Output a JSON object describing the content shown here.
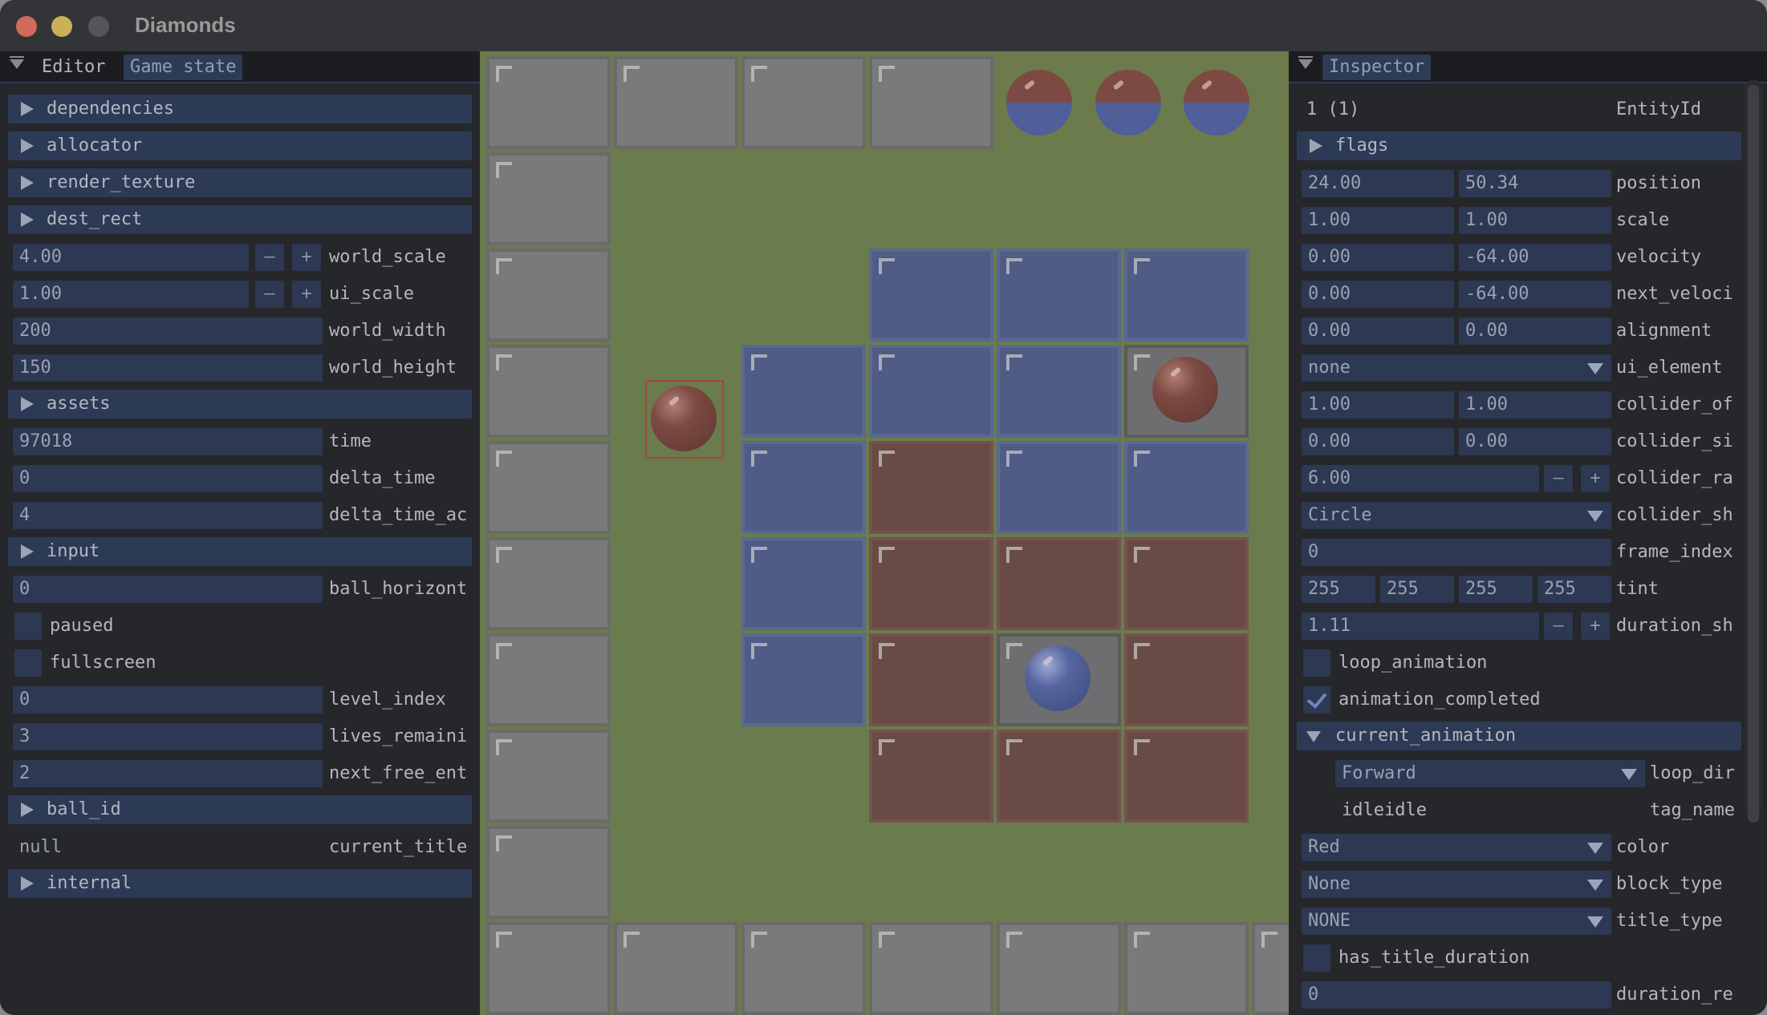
{
  "window": {
    "title": "Diamonds"
  },
  "left_panel": {
    "tabs": [
      "Editor",
      "Game state"
    ],
    "active_tab": "Game state",
    "sections": {
      "dependencies": "dependencies",
      "allocator": "allocator",
      "render_texture": "render_texture",
      "dest_rect": "dest_rect",
      "assets": "assets",
      "input": "input",
      "ball_id": "ball_id",
      "internal": "internal"
    },
    "fields": {
      "world_scale": {
        "value": "4.00",
        "label": "world_scale"
      },
      "ui_scale": {
        "value": "1.00",
        "label": "ui_scale"
      },
      "world_width": {
        "value": "200",
        "label": "world_width"
      },
      "world_height": {
        "value": "150",
        "label": "world_height"
      },
      "time": {
        "value": "97018",
        "label": "time"
      },
      "delta_time": {
        "value": "0",
        "label": "delta_time"
      },
      "delta_time_ac": {
        "value": "4",
        "label": "delta_time_ac"
      },
      "ball_horizont": {
        "value": "0",
        "label": "ball_horizont"
      },
      "paused": {
        "label": "paused",
        "checked": false
      },
      "fullscreen": {
        "label": "fullscreen",
        "checked": false
      },
      "level_index": {
        "value": "0",
        "label": "level_index"
      },
      "lives_remaini": {
        "value": "3",
        "label": "lives_remaini"
      },
      "next_free_ent": {
        "value": "2",
        "label": "next_free_ent"
      },
      "current_title": {
        "value": "null",
        "label": "current_title"
      }
    },
    "stepper": {
      "minus": "–",
      "plus": "+"
    }
  },
  "inspector": {
    "tab": "Inspector",
    "entity": {
      "value": "1 (1)",
      "label": "EntityId"
    },
    "flags": "flags",
    "position": {
      "x": "24.00",
      "y": "50.34",
      "label": "position"
    },
    "scale": {
      "x": "1.00",
      "y": "1.00",
      "label": "scale"
    },
    "velocity": {
      "x": "0.00",
      "y": "-64.00",
      "label": "velocity"
    },
    "next_velocity": {
      "x": "0.00",
      "y": "-64.00",
      "label": "next_veloci"
    },
    "alignment": {
      "x": "0.00",
      "y": "0.00",
      "label": "alignment"
    },
    "ui_element": {
      "value": "none",
      "label": "ui_element"
    },
    "collider_of": {
      "x": "1.00",
      "y": "1.00",
      "label": "collider_of"
    },
    "collider_si": {
      "x": "0.00",
      "y": "0.00",
      "label": "collider_si"
    },
    "collider_ra": {
      "value": "6.00",
      "label": "collider_ra"
    },
    "collider_sh": {
      "value": "Circle",
      "label": "collider_sh"
    },
    "frame_index": {
      "value": "0",
      "label": "frame_index"
    },
    "tint": {
      "r": "255",
      "g": "255",
      "b": "255",
      "a": "255",
      "label": "tint"
    },
    "duration_sh": {
      "value": "1.11",
      "label": "duration_sh"
    },
    "loop_animation": {
      "label": "loop_animation",
      "checked": false
    },
    "animation_completed": {
      "label": "animation_completed",
      "checked": true
    },
    "current_animation": "current_animation",
    "loop_dir": {
      "value": "Forward",
      "label": "loop_dir"
    },
    "tag_name": {
      "value": "idleidle",
      "label": "tag_name"
    },
    "color": {
      "value": "Red",
      "label": "color"
    },
    "block_type": {
      "value": "None",
      "label": "block_type"
    },
    "title_type": {
      "value": "NONE",
      "label": "title_type"
    },
    "has_title_duration": {
      "label": "has_title_duration",
      "checked": false
    },
    "duration_re": {
      "value": "0",
      "label": "duration_re"
    }
  },
  "colors": {
    "header": "#2c3a55",
    "field": "#2d3852",
    "grass": "#6a7b4d",
    "blue_block": "#4e5c86",
    "red_block": "#6a4a45",
    "wall": "#7a7a7b"
  }
}
